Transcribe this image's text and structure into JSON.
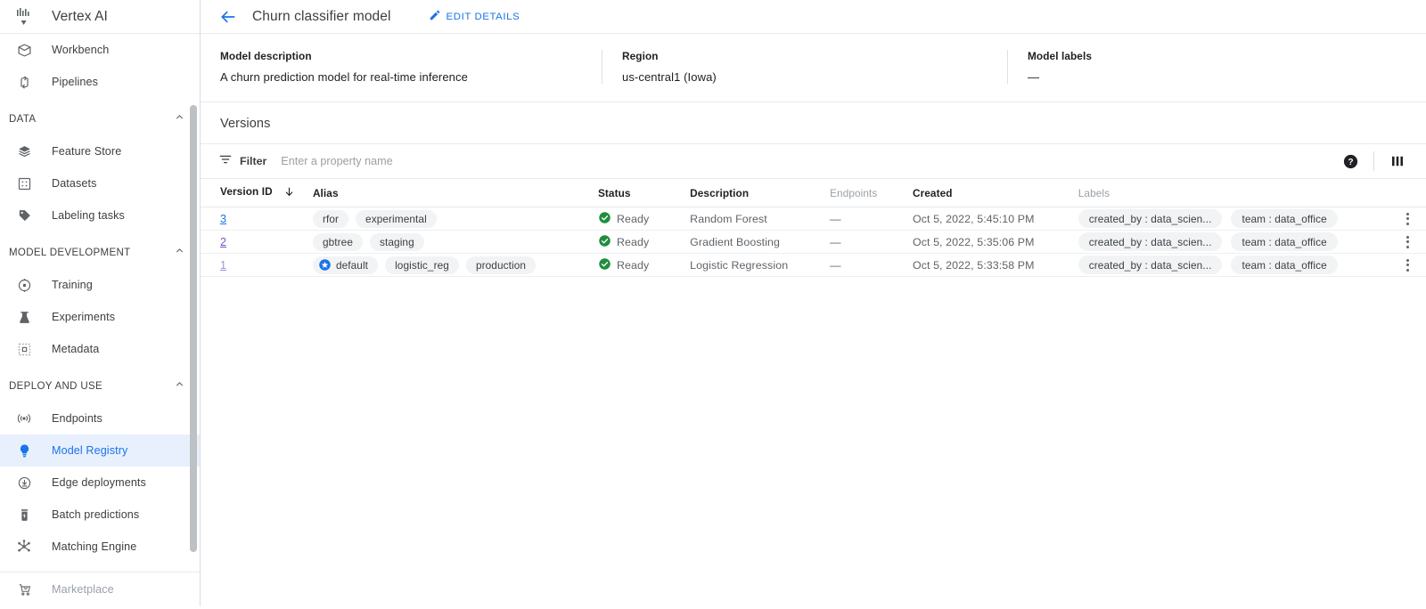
{
  "sidebar": {
    "brand": {
      "title": "Vertex AI",
      "logo_icon": "vertex-ai-logo-icon"
    },
    "top_items": [
      {
        "label": "Workbench",
        "icon": "workbench-icon"
      },
      {
        "label": "Pipelines",
        "icon": "pipelines-icon"
      }
    ],
    "sections": [
      {
        "label": "DATA",
        "chevron": "chevron-up-icon",
        "items": [
          {
            "label": "Feature Store",
            "icon": "feature-store-icon"
          },
          {
            "label": "Datasets",
            "icon": "datasets-icon"
          },
          {
            "label": "Labeling tasks",
            "icon": "labeling-tasks-icon"
          }
        ]
      },
      {
        "label": "MODEL DEVELOPMENT",
        "chevron": "chevron-up-icon",
        "items": [
          {
            "label": "Training",
            "icon": "training-icon"
          },
          {
            "label": "Experiments",
            "icon": "experiments-icon"
          },
          {
            "label": "Metadata",
            "icon": "metadata-icon"
          }
        ]
      },
      {
        "label": "DEPLOY AND USE",
        "chevron": "chevron-up-icon",
        "items": [
          {
            "label": "Endpoints",
            "icon": "endpoints-icon"
          },
          {
            "label": "Model Registry",
            "icon": "model-registry-icon",
            "active": true
          },
          {
            "label": "Edge deployments",
            "icon": "edge-deployments-icon"
          },
          {
            "label": "Batch predictions",
            "icon": "batch-predictions-icon"
          },
          {
            "label": "Matching Engine",
            "icon": "matching-engine-icon"
          }
        ]
      }
    ],
    "bottom_item": {
      "label": "Marketplace",
      "icon": "marketplace-cart-icon"
    }
  },
  "topbar": {
    "back_icon": "back-arrow-icon",
    "title": "Churn classifier model",
    "edit_details_label": "EDIT DETAILS",
    "edit_icon": "pencil-icon"
  },
  "meta": {
    "description_label": "Model description",
    "description_value": "A churn prediction model for real-time inference",
    "region_label": "Region",
    "region_value": "us-central1 (Iowa)",
    "labels_label": "Model labels",
    "labels_value": "—"
  },
  "versions": {
    "heading": "Versions",
    "filter": {
      "icon": "filter-icon",
      "label": "Filter",
      "placeholder": "Enter a property name",
      "value": ""
    },
    "help_icon": "help-circle-icon",
    "columns_icon": "column-settings-icon",
    "columns": [
      {
        "label": "Version ID",
        "sort_icon": "sort-arrow-down-icon",
        "dim": false
      },
      {
        "label": "Alias",
        "dim": false
      },
      {
        "label": "Status",
        "dim": false
      },
      {
        "label": "Description",
        "dim": false
      },
      {
        "label": "Endpoints",
        "dim": true
      },
      {
        "label": "Created",
        "dim": false
      },
      {
        "label": "Labels",
        "dim": true
      }
    ],
    "rows": [
      {
        "version_id": "3",
        "link_style": "v3",
        "aliases": [
          {
            "text": "rfor",
            "icon": null
          },
          {
            "text": "experimental",
            "icon": null
          }
        ],
        "status": "Ready",
        "status_icon": "check-circle-icon",
        "description": "Random Forest",
        "endpoints": "—",
        "created": "Oct 5, 2022, 5:45:10 PM",
        "labels": [
          "created_by : data_scien...",
          "team : data_office"
        ],
        "menu_icon": "more-vert-icon"
      },
      {
        "version_id": "2",
        "link_style": "v2",
        "aliases": [
          {
            "text": "gbtree",
            "icon": null
          },
          {
            "text": "staging",
            "icon": null
          }
        ],
        "status": "Ready",
        "status_icon": "check-circle-icon",
        "description": "Gradient Boosting",
        "endpoints": "—",
        "created": "Oct 5, 2022, 5:35:06 PM",
        "labels": [
          "created_by : data_scien...",
          "team : data_office"
        ],
        "menu_icon": "more-vert-icon"
      },
      {
        "version_id": "1",
        "link_style": "v1",
        "aliases": [
          {
            "text": "default",
            "icon": "star-circle-icon"
          },
          {
            "text": "logistic_reg",
            "icon": null
          },
          {
            "text": "production",
            "icon": null
          }
        ],
        "status": "Ready",
        "status_icon": "check-circle-icon",
        "description": "Logistic Regression",
        "endpoints": "—",
        "created": "Oct 5, 2022, 5:33:58 PM",
        "labels": [
          "created_by : data_scien...",
          "team : data_office"
        ],
        "menu_icon": "more-vert-icon"
      }
    ]
  },
  "colors": {
    "accent_blue": "#1a73e8",
    "active_bg": "#e8f0fe",
    "status_green": "#1e8e3e",
    "visited_purple": "#7b4fcf",
    "chip_bg": "#f1f3f4",
    "text_primary": "#202124",
    "text_secondary": "#5f6368",
    "text_muted": "#9aa0a6"
  }
}
